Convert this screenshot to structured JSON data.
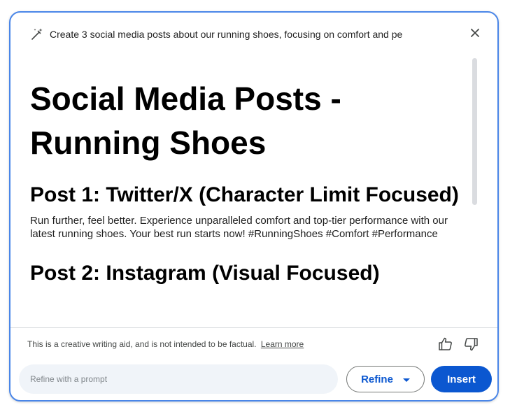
{
  "header": {
    "prompt": "Create 3 social media posts about our running shoes, focusing on comfort and pe",
    "close_icon": "close-icon",
    "pen_icon": "magic-pen-icon"
  },
  "content": {
    "title": "Social Media Posts - Running Shoes",
    "posts": [
      {
        "heading": "Post 1: Twitter/X (Character Limit Focused)",
        "body": "Run further, feel better. Experience unparalleled comfort and top-tier performance with our latest running shoes. Your best run starts now! #RunningShoes #Comfort #Performance"
      },
      {
        "heading": "Post 2: Instagram (Visual Focused)"
      }
    ]
  },
  "footer": {
    "disclaimer": "This is a creative writing aid, and is not intended to be factual.",
    "learn_more": "Learn more",
    "thumbs_up_icon": "thumbs-up-icon",
    "thumbs_down_icon": "thumbs-down-icon",
    "refine_placeholder": "Refine with a prompt",
    "refine_label": "Refine",
    "insert_label": "Insert"
  },
  "colors": {
    "accent": "#0b57d0",
    "border": "#4a86e8",
    "input_bg": "#f0f4f9"
  }
}
